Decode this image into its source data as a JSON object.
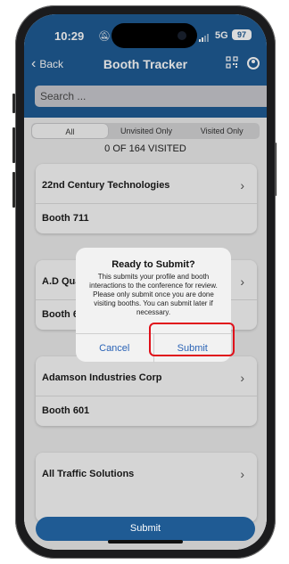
{
  "status_bar": {
    "time": "10:29",
    "network": "5G",
    "battery": "97"
  },
  "nav": {
    "back_label": "Back",
    "title": "Booth Tracker",
    "icons": [
      "qr-code-icon",
      "user-profile-icon"
    ]
  },
  "search": {
    "placeholder": "Search ..."
  },
  "filter_tabs": [
    {
      "label": "All",
      "selected": true
    },
    {
      "label": "Unvisited Only",
      "selected": false
    },
    {
      "label": "Visited Only",
      "selected": false
    }
  ],
  "visited_count": "0 OF 164 VISITED",
  "exhibitors": [
    {
      "name": "22nd Century Technologies",
      "booth": "Booth 711"
    },
    {
      "name": "A.D Qua",
      "booth": "Booth 6"
    },
    {
      "name": "Adamson Industries Corp",
      "booth": "Booth 601"
    },
    {
      "name": "All Traffic Solutions",
      "booth": ""
    }
  ],
  "submit_label": "Submit",
  "dialog": {
    "title": "Ready to Submit?",
    "message": "This submits your profile and booth interactions to the conference for review. Please only submit once you are done visiting booths. You can submit later if necessary.",
    "cancel_label": "Cancel",
    "submit_label": "Submit"
  },
  "colors": {
    "brand_blue": "#1f5b94",
    "alert_link_blue": "#2a63b6",
    "highlight_red": "#e0101a"
  }
}
